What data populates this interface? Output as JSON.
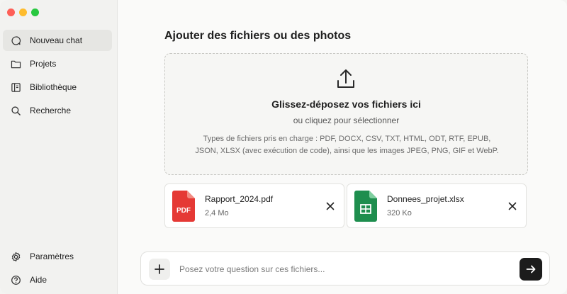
{
  "sidebar": {
    "items": [
      {
        "label": "Nouveau chat",
        "icon": "new-chat-icon"
      },
      {
        "label": "Projets",
        "icon": "folder-icon"
      },
      {
        "label": "Bibliothèque",
        "icon": "library-icon"
      },
      {
        "label": "Recherche",
        "icon": "search-icon"
      }
    ],
    "bottom": [
      {
        "label": "Paramètres",
        "icon": "gear-icon"
      },
      {
        "label": "Aide",
        "icon": "help-icon"
      }
    ]
  },
  "main": {
    "title": "Ajouter des fichiers ou des photos",
    "dropzone": {
      "title": "Glissez-déposez vos fichiers ici",
      "subtitle": "ou cliquez pour sélectionner",
      "types_line1": "Types de fichiers pris en charge : PDF, DOCX, CSV, TXT, HTML, ODT, RTF, EPUB,",
      "types_line2": "JSON, XLSX (avec exécution de code), ainsi que les images JPEG, PNG, GIF et WebP."
    },
    "files": [
      {
        "name": "Rapport_2024.pdf",
        "size": "2,4 Mo",
        "thumb_label": "PDF",
        "color": "#e53935"
      },
      {
        "name": "Donnees_projet.xlsx",
        "size": "320 Ko",
        "color": "#1e8e4e"
      }
    ]
  },
  "composer": {
    "placeholder": "Posez votre question sur ces fichiers..."
  },
  "colors": {
    "accent_dark": "#1c1c1c",
    "pdf_red": "#e53935",
    "sheet_green": "#1e8e4e"
  }
}
